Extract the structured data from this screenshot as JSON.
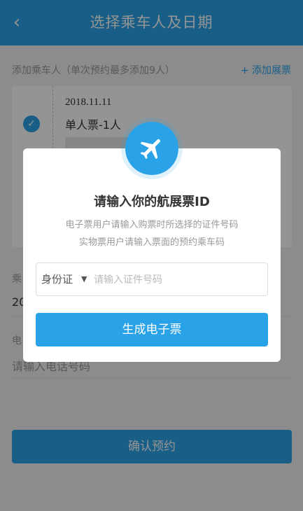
{
  "header": {
    "back_icon": "chevron-left-icon",
    "back_glyph": "‹",
    "title": "选择乘车人及日期"
  },
  "passengers": {
    "section_label": "添加乘车人（单次预约最多添加9人）",
    "add_link": "+ 添加展票",
    "ticket": {
      "date": "2018.11.11",
      "type": "单人票-1人",
      "checked": true
    }
  },
  "form": {
    "rider_label": "乘",
    "rider_value": "20",
    "phone_label": "电",
    "phone_placeholder": "请输入电话号码"
  },
  "confirm_button": "确认预约",
  "modal": {
    "icon": "airplane-icon",
    "title": "请输入你的航展票ID",
    "subtitle_line1": "电子票用户请输入购票时所选择的证件号码",
    "subtitle_line2": "实物票用户请输入票面的预约乘车码",
    "id_type": "身份证",
    "id_type_caret": "▼",
    "id_placeholder": "请输入证件号码",
    "generate_button": "生成电子票"
  },
  "colors": {
    "accent": "#2aa2e7",
    "background": "#f2f2f2"
  }
}
